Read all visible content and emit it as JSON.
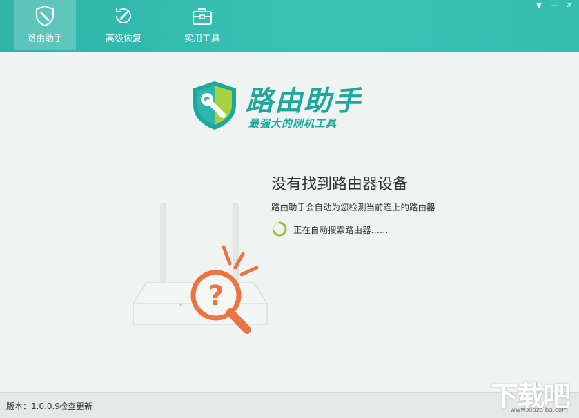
{
  "window": {
    "minimize_glyph": "▼",
    "minimize2_glyph": "—",
    "close_glyph": "✕"
  },
  "tabs": [
    {
      "label": "路由助手",
      "icon": "shield-wrench-icon",
      "active": true
    },
    {
      "label": "高级恢复",
      "icon": "restore-brush-icon",
      "active": false
    },
    {
      "label": "实用工具",
      "icon": "toolbox-icon",
      "active": false
    }
  ],
  "logo": {
    "title": "路由助手",
    "subtitle": "最强大的刷机工具",
    "icon": "shield-wrench-icon"
  },
  "status": {
    "title": "没有找到路由器设备",
    "description": "路由助手会自动为您检测当前连上的路由器",
    "searching_text": "正在自动搜索路由器……"
  },
  "illustration": {
    "icon": "router-question-icon"
  },
  "footer": {
    "version": "版本：1.0.0.9",
    "check_update": "检查更新"
  },
  "watermark": {
    "text": "下载吧",
    "url": "www.xiazaiba.com"
  },
  "colors": {
    "header": "#38c3b5",
    "accent": "#1ea89c",
    "orange": "#ee7343",
    "spinner_green": "#8dc63f",
    "background": "#eff3f2"
  }
}
